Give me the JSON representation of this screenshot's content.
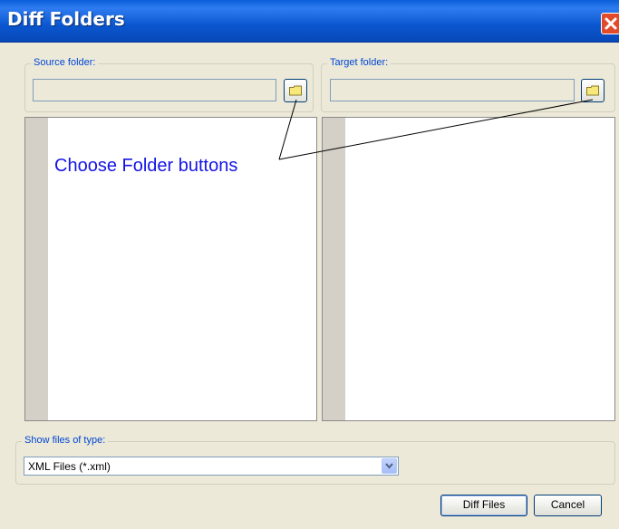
{
  "window": {
    "title": "Diff Folders"
  },
  "source": {
    "label": "Source folder:",
    "path": ""
  },
  "target": {
    "label": "Target folder:",
    "path": ""
  },
  "annotation": {
    "text": "Choose Folder buttons"
  },
  "filter": {
    "label": "Show files of type:",
    "selected": "XML Files (*.xml)"
  },
  "buttons": {
    "diff": "Diff Files",
    "cancel": "Cancel"
  },
  "icons": {
    "close": "close-icon",
    "folder": "folder-icon",
    "dropdown": "chevron-down-icon"
  },
  "colors": {
    "title_bar": "#0b57d0",
    "close_button": "#e24b2a",
    "annotation": "#1414e6",
    "group_label": "#0046d5"
  }
}
